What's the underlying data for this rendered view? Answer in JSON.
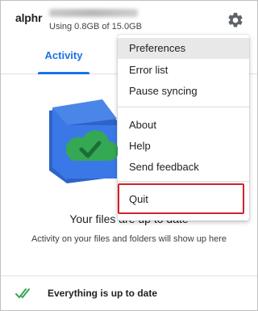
{
  "header": {
    "brand": "alphr",
    "storage": "Using 0.8GB of 15.0GB"
  },
  "tabs": [
    {
      "label": "Activity",
      "active": true
    }
  ],
  "main": {
    "title": "Your files are up to date",
    "subtitle": "Activity on your files and folders will show up here"
  },
  "footer": {
    "status": "Everything is up to date"
  },
  "menu": {
    "items": [
      {
        "label": "Preferences",
        "highlighted": true
      },
      {
        "label": "Error list"
      },
      {
        "label": "Pause syncing"
      },
      {
        "label": "About"
      },
      {
        "label": "Help"
      },
      {
        "label": "Send feedback"
      },
      {
        "label": "Quit",
        "annotated": true
      }
    ]
  },
  "colors": {
    "accent": "#1a73e8",
    "annotation": "#d0232d",
    "folder_blue": "#3b78e7",
    "cloud_green": "#34a853"
  },
  "icons": [
    "gear-icon",
    "cloud-check-icon",
    "double-check-icon"
  ]
}
